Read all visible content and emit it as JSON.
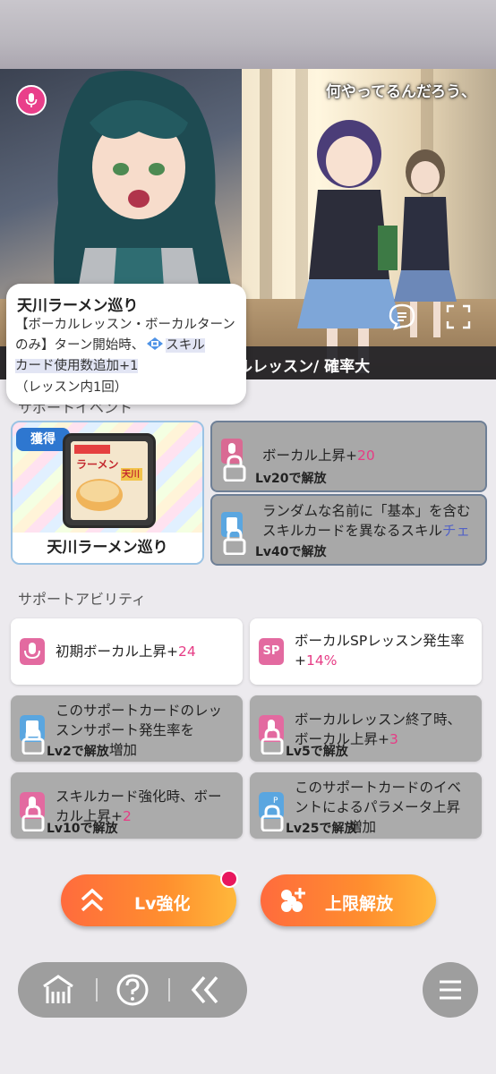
{
  "illustration": {
    "voice_line": "何やってるんだろう、",
    "skill_bar_text": "ルレッスン/ 確率大",
    "icons": [
      "microphone-icon",
      "chat-bubble-icon",
      "fullscreen-icon"
    ]
  },
  "tooltip": {
    "title": "天川ラーメン巡り",
    "line1": "【ボーカルレッスン・ボーカルターンのみ】ターン開始時、",
    "highlight": "スキルカード使用数追加+1",
    "highlight_a": "スキル",
    "highlight_b": "カード使用数追加+1",
    "note": "（レッスン内1回）"
  },
  "support_event": {
    "heading": "サポートイベント",
    "acquired_badge": "獲得",
    "acquired_label": "天川ラーメン巡り",
    "event_img_text": [
      "天川",
      "ラーメン"
    ],
    "locked": [
      {
        "text": "ボーカル上昇+",
        "value": "20",
        "unlock": "Lv20で解放"
      },
      {
        "text": "ランダムな名前に「基本」を含むスキルカードを異なるスキル",
        "tail": "チェンジ",
        "unlock": "Lv40で解放"
      }
    ]
  },
  "support_ability": {
    "heading": "サポートアビリティ",
    "cards": [
      {
        "text": "初期ボーカル上昇+",
        "value": "24",
        "unlock": ""
      },
      {
        "text": "ボーカルSPレッスン発生率+",
        "value": "14%",
        "unlock": ""
      },
      {
        "text": "このサポートカードのレッスンサポート発生率を",
        "value": "",
        "tail": "増加",
        "unlock": "Lv2で解放"
      },
      {
        "text": "ボーカルレッスン終了時、ボーカル上昇+",
        "value": "3",
        "unlock": "Lv5で解放"
      },
      {
        "text": "スキルカード強化時、ボーカル上昇+",
        "value": "2",
        "unlock": "Lv10で解放"
      },
      {
        "text": "このサポートカードのイベントによるパラメータ上昇",
        "value": "",
        "tail": "増加",
        "unlock": "Lv25で解放"
      }
    ],
    "sp_badge": "SP"
  },
  "actions": {
    "lv_up": "Lv強化",
    "limit_break": "上限解放"
  },
  "colors": {
    "accent_pink": "#e63c85",
    "button_orange": "#ff8f2e",
    "badge_blue": "#2e77d0"
  }
}
